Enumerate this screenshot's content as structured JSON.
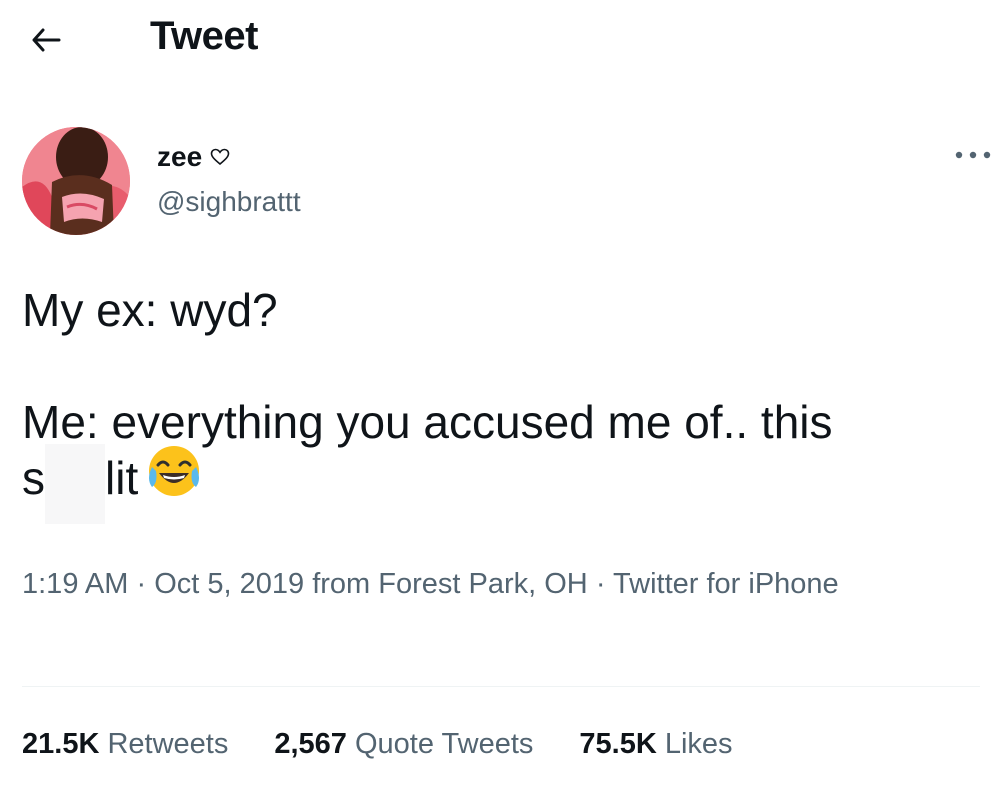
{
  "header": {
    "back_icon": "arrow-left-icon",
    "title": "Tweet"
  },
  "author": {
    "display_name": "zee",
    "name_badge_icon": "heart-outline-icon",
    "handle": "@sighbrattt",
    "more_icon": "more-horizontal-icon"
  },
  "tweet": {
    "line1": "My ex: wyd?",
    "line2": "Me: everything you accused me of.. this",
    "line3_start": "s",
    "line3_end": "lit",
    "emoji": "face-with-tears-of-joy-icon"
  },
  "meta": {
    "time": "1:19 AM",
    "separator": "·",
    "date": "Oct 5, 2019",
    "location": "from Forest Park, OH",
    "source": "Twitter for iPhone"
  },
  "stats": {
    "retweets_count": "21.5K",
    "retweets_label": "Retweets",
    "quotes_count": "2,567",
    "quotes_label": "Quote Tweets",
    "likes_count": "75.5K",
    "likes_label": "Likes"
  },
  "colors": {
    "text_primary": "#0f1419",
    "text_secondary": "#536471",
    "divider": "#eff3f4"
  }
}
